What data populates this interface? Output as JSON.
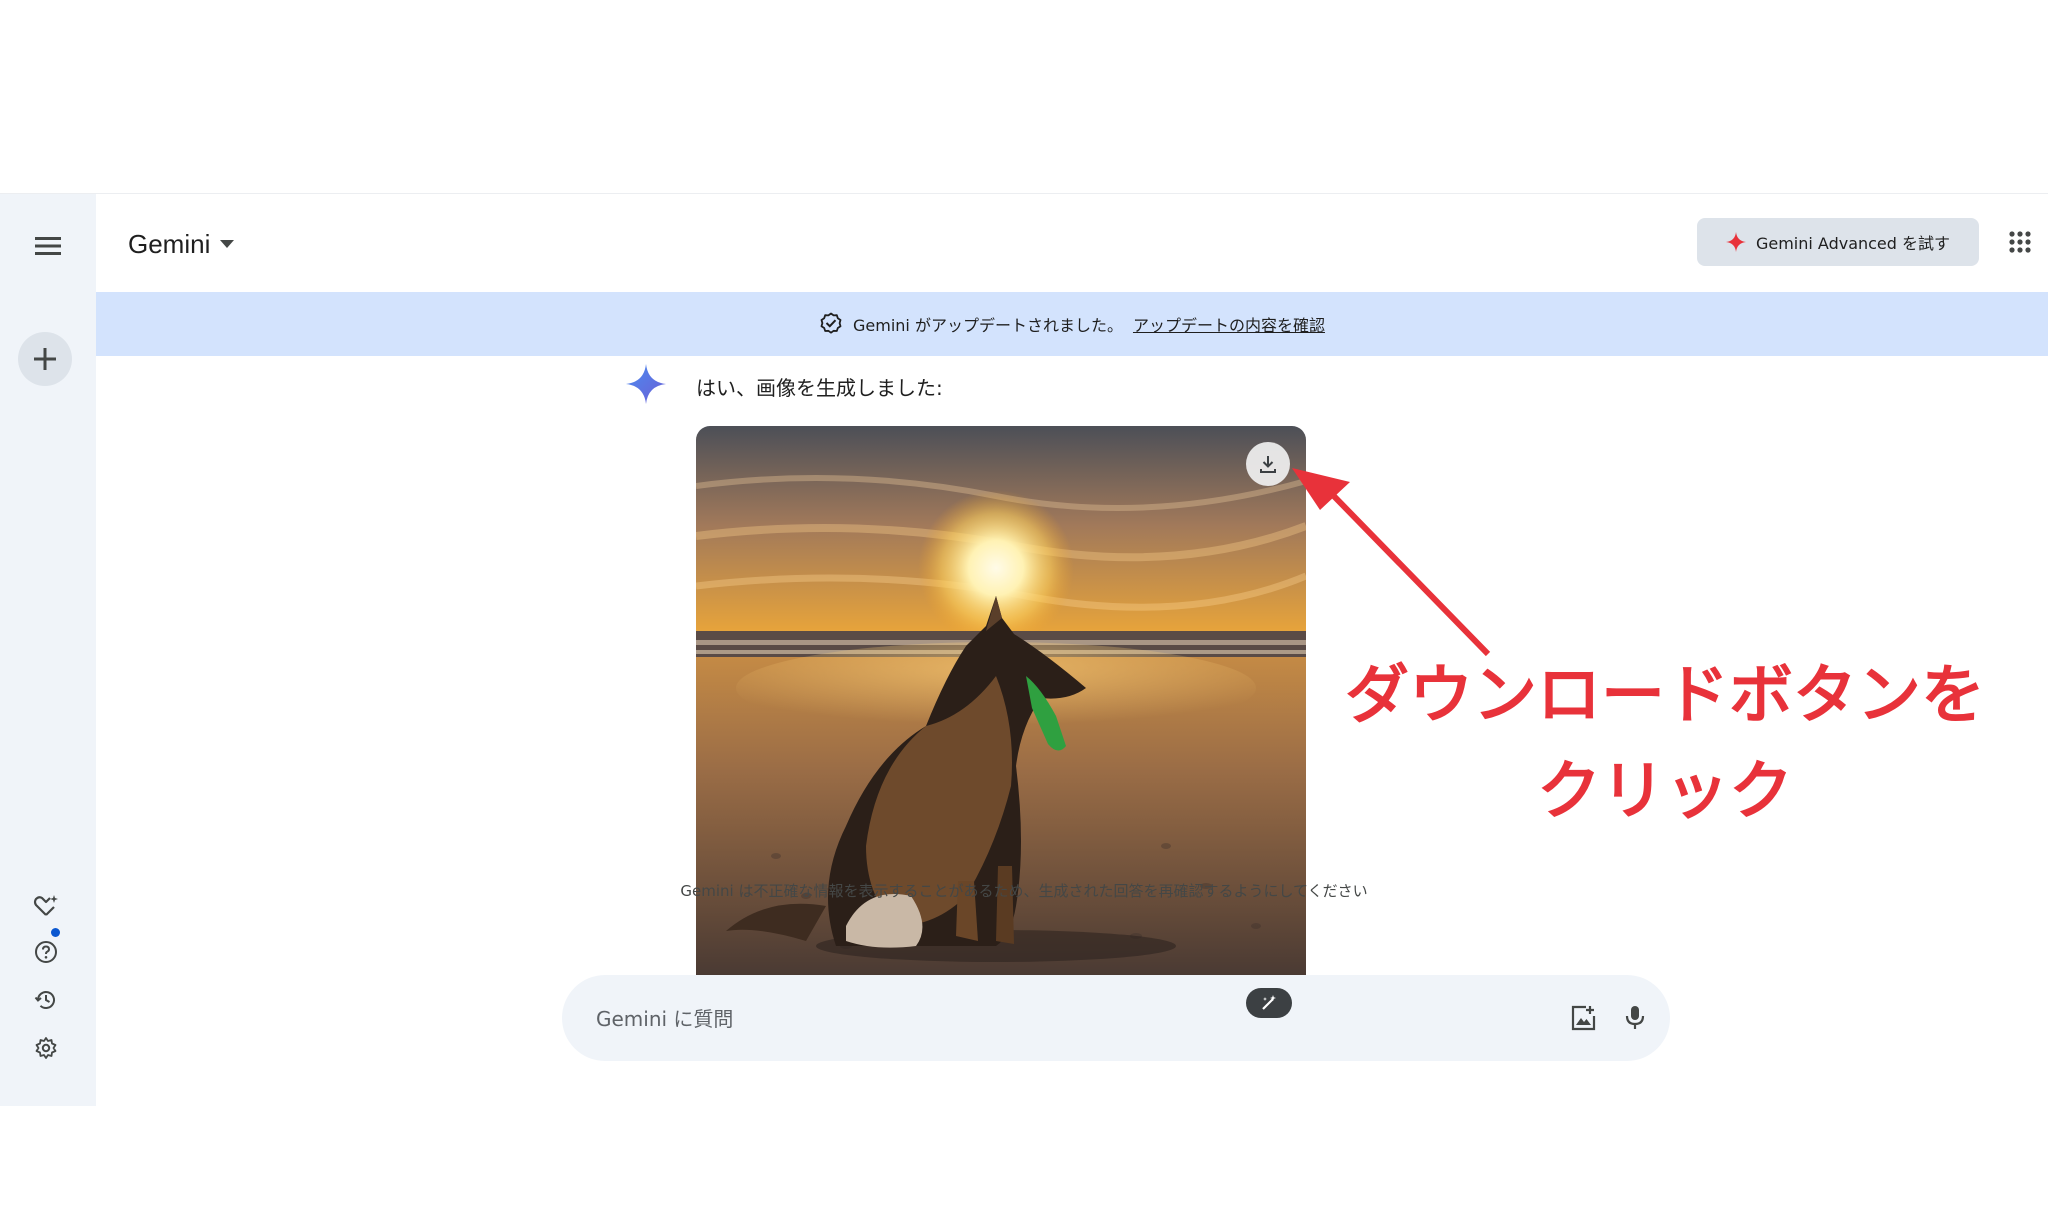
{
  "header": {
    "title": "Gemini",
    "advanced_label": "Gemini Advanced を試す"
  },
  "banner": {
    "text": "Gemini がアップデートされました。",
    "link": "アップデートの内容を確認"
  },
  "response": {
    "text": "はい、画像を生成しました:"
  },
  "input": {
    "placeholder": "Gemini に質問"
  },
  "disclaimer": "Gemini は不正確な情報を表示することがあるため、生成された回答を再確認するようにしてください",
  "annotation": {
    "line1": "ダウンロードボタンを",
    "line2": "クリック",
    "color": "#e8323a"
  },
  "colors": {
    "sidebar_bg": "#f0f4f9",
    "banner_bg": "#d3e3fd",
    "accent_blue": "#0b57d0",
    "advanced_spark": "#e8323a"
  },
  "icons": {
    "menu": "menu-icon",
    "new_chat": "plus-icon",
    "gem_manager": "gem-icon",
    "help": "help-icon",
    "activity": "history-icon",
    "settings": "gear-icon",
    "model_dropdown": "caret-down-icon",
    "apps": "apps-grid-icon",
    "verified": "verified-check-icon",
    "gemini_spark": "gemini-spark-icon",
    "download": "download-icon",
    "magic": "magic-wand-icon",
    "upload_image": "image-upload-icon",
    "microphone": "microphone-icon"
  }
}
